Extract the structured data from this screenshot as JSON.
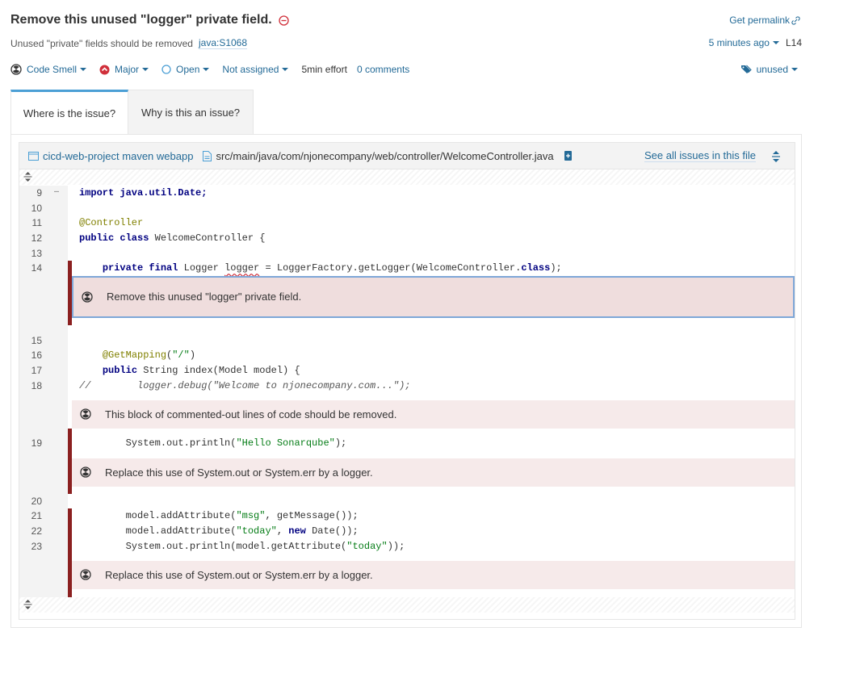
{
  "issue": {
    "title": "Remove this unused \"logger\" private field.",
    "permalink_label": "Get permalink",
    "rule_description": "Unused \"private\" fields should be removed",
    "rule_key": "java:S1068",
    "time_ago": "5 minutes ago",
    "line_ref": "L14",
    "type": "Code Smell",
    "severity": "Major",
    "status": "Open",
    "assignee": "Not assigned",
    "effort": "5min effort",
    "comments": "0 comments",
    "tag": "unused"
  },
  "tabs": [
    {
      "label": "Where is the issue?",
      "active": true
    },
    {
      "label": "Why is this an issue?",
      "active": false
    }
  ],
  "viewer": {
    "project": "cicd-web-project maven webapp",
    "file_path": "src/main/java/com/njonecompany/web/controller/WelcomeController.java",
    "see_all": "See all issues in this file"
  },
  "code": {
    "line9": {
      "num": "9",
      "dots": "…",
      "text": "import java.util.Date;"
    },
    "line10": {
      "num": "10"
    },
    "line11": {
      "num": "11",
      "text": "@Controller"
    },
    "line12": {
      "num": "12",
      "kw": "public class",
      "text": " WelcomeController {"
    },
    "line13": {
      "num": "13"
    },
    "line14": {
      "num": "14",
      "kw": "private final",
      "pre": " Logger ",
      "var": "logger",
      "post": " = LoggerFactory.getLogger(WelcomeController.",
      "kw2": "class",
      "end": ");"
    },
    "line15": {
      "num": "15"
    },
    "line16": {
      "num": "16",
      "ann": "@GetMapping",
      "pre": "(",
      "str": "\"/\"",
      "post": ")"
    },
    "line17": {
      "num": "17",
      "kw": "public",
      "text": " String index(Model model) {"
    },
    "line18": {
      "num": "18",
      "text": "//        logger.debug(\"Welcome to njonecompany.com...\");"
    },
    "line19": {
      "num": "19",
      "pre": "System.out.println(",
      "str": "\"Hello Sonarqube\"",
      "post": ");"
    },
    "line20": {
      "num": "20"
    },
    "line21": {
      "num": "21",
      "pre": "model.addAttribute(",
      "str": "\"msg\"",
      "post": ", getMessage());"
    },
    "line22": {
      "num": "22",
      "pre": "model.addAttribute(",
      "str": "\"today\"",
      "mid": ", ",
      "kw": "new",
      "post": " Date());"
    },
    "line23": {
      "num": "23",
      "pre": "System.out.println(model.getAttribute(",
      "str": "\"today\"",
      "post": "));"
    }
  },
  "messages": {
    "m1": "Remove this unused \"logger\" private field.",
    "m2": "This block of commented-out lines of code should be removed.",
    "m3": "Replace this use of System.out or System.err by a logger.",
    "m4": "Replace this use of System.out or System.err by a logger."
  },
  "colors": {
    "link": "#236a97",
    "issue_marker": "#8b2020",
    "selected_border": "#7ea7d8"
  }
}
